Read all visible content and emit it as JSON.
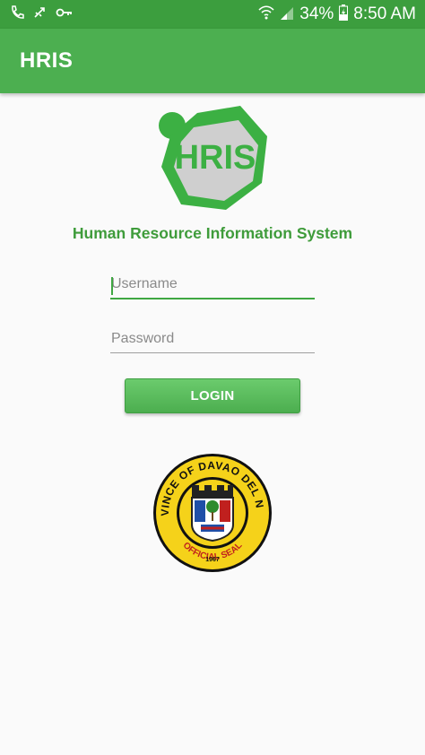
{
  "status_bar": {
    "battery": "34%",
    "time": "8:50 AM",
    "icons": [
      "phone-icon",
      "usb-icon",
      "key-icon",
      "wifi-icon",
      "signal-icon",
      "battery-charging-icon"
    ]
  },
  "app_bar": {
    "title": "HRIS"
  },
  "logo": {
    "text": "HRIS",
    "colors": {
      "green": "#3cb043",
      "gray": "#cfcfcf",
      "dark": "#5b5b5b"
    }
  },
  "subtitle": "Human Resource Information System",
  "form": {
    "username_placeholder": "Username",
    "password_placeholder": "Password",
    "login_label": "LOGIN"
  },
  "seal": {
    "top_text": "PROVINCE OF DAVAO DEL NORTE",
    "bottom_text": "OFFICIAL SEAL",
    "year": "1967"
  },
  "colors": {
    "status_bar": "#3c9e3e",
    "app_bar": "#4caf50",
    "accent": "#3fa742",
    "seal_yellow": "#f5d21a"
  }
}
